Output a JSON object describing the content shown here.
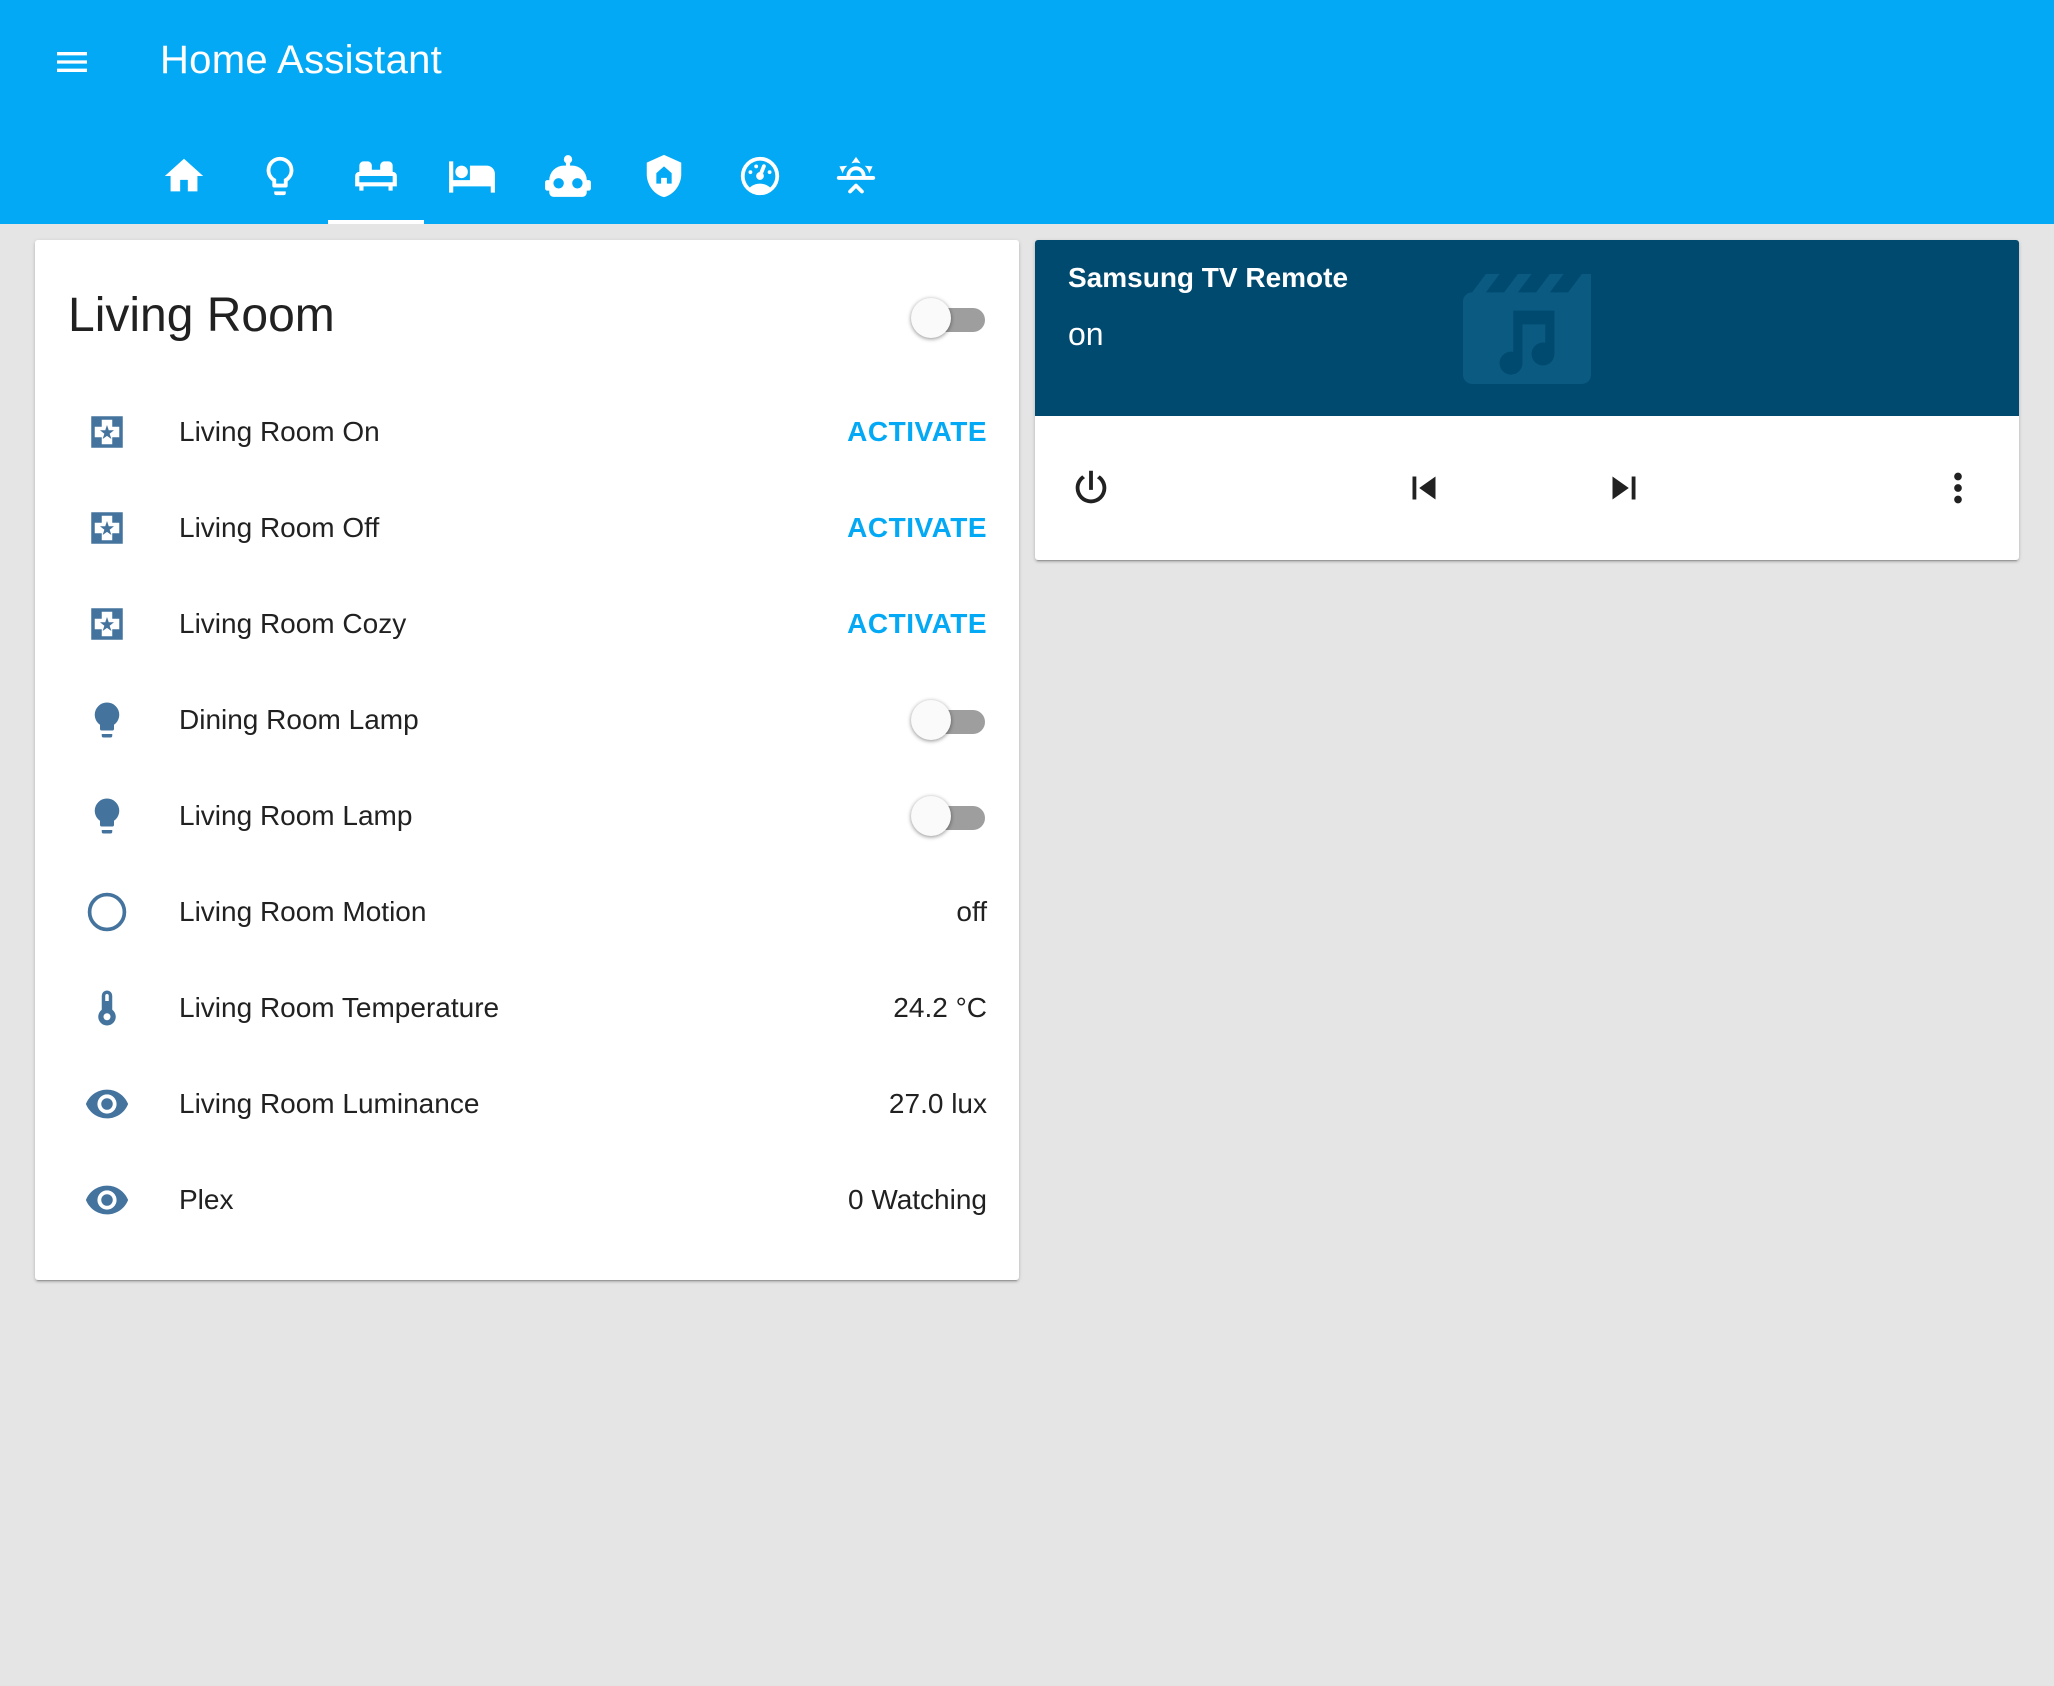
{
  "header": {
    "title": "Home Assistant",
    "tabs": [
      {
        "icon": "home-icon",
        "active": false
      },
      {
        "icon": "lightbulb-icon",
        "active": false
      },
      {
        "icon": "sofa-icon",
        "active": true
      },
      {
        "icon": "bed-icon",
        "active": false
      },
      {
        "icon": "robot-icon",
        "active": false
      },
      {
        "icon": "shield-home-icon",
        "active": false
      },
      {
        "icon": "gauge-icon",
        "active": false
      },
      {
        "icon": "weather-sunset-icon",
        "active": false
      }
    ]
  },
  "group": {
    "title": "Living Room",
    "toggle_on": false,
    "rows": [
      {
        "name": "Living Room On",
        "type": "scene",
        "action": "ACTIVATE",
        "icon": "scene-icon"
      },
      {
        "name": "Living Room Off",
        "type": "scene",
        "action": "ACTIVATE",
        "icon": "scene-icon"
      },
      {
        "name": "Living Room Cozy",
        "type": "scene",
        "action": "ACTIVATE",
        "icon": "scene-icon"
      },
      {
        "name": "Dining Room Lamp",
        "type": "toggle",
        "on": false,
        "icon": "lightbulb-icon"
      },
      {
        "name": "Living Room Lamp",
        "type": "toggle",
        "on": false,
        "icon": "lightbulb-icon"
      },
      {
        "name": "Living Room Motion",
        "type": "state",
        "state": "off",
        "icon": "motion-off-icon"
      },
      {
        "name": "Living Room Temperature",
        "type": "state",
        "state": "24.2 °C",
        "icon": "thermometer-icon"
      },
      {
        "name": "Living Room Luminance",
        "type": "state",
        "state": "27.0 lux",
        "icon": "eye-icon"
      },
      {
        "name": "Plex",
        "type": "state",
        "state": "0 Watching",
        "icon": "eye-icon"
      }
    ]
  },
  "media": {
    "title": "Samsung TV Remote",
    "state": "on",
    "art_icon": "movie-music-icon",
    "controls": [
      "power-icon",
      "skip-previous-icon",
      "skip-next-icon",
      "dots-vertical-icon"
    ]
  },
  "colors": {
    "primary": "#03a9f4",
    "icon": "#44739e",
    "media_header": "#004a6f",
    "background": "#e5e5e5"
  }
}
